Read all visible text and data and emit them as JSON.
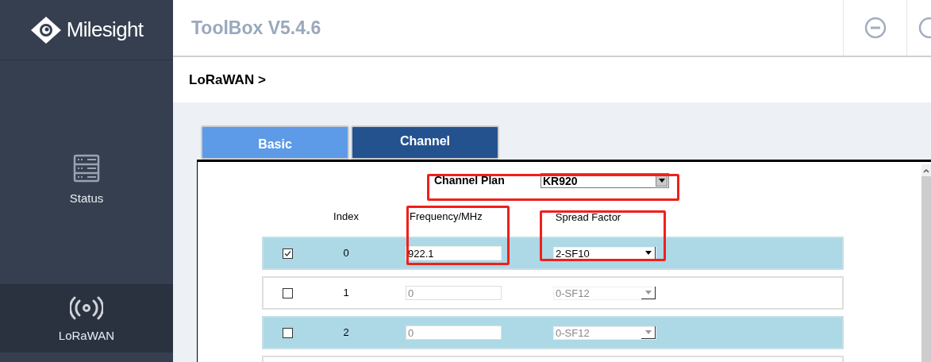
{
  "brand": "Milesight",
  "app_title": "ToolBox V5.4.6",
  "sidebar": {
    "items": [
      {
        "label": "Status",
        "selected": false
      },
      {
        "label": "LoRaWAN",
        "selected": true
      }
    ]
  },
  "breadcrumb": "LoRaWAN >",
  "tabs": [
    {
      "label": "Basic",
      "selected": false
    },
    {
      "label": "Channel",
      "selected": true
    }
  ],
  "channel_plan": {
    "label": "Channel Plan",
    "value": "KR920",
    "highlighted": true
  },
  "table": {
    "columns": [
      {
        "label": "Index",
        "highlighted": false
      },
      {
        "label": "Frequency/MHz",
        "highlighted": true
      },
      {
        "label": "Spread Factor",
        "highlighted": true
      }
    ],
    "rows": [
      {
        "checked": true,
        "index": "0",
        "frequency": "922.1",
        "spread_factor": "2-SF10"
      },
      {
        "checked": false,
        "index": "1",
        "frequency": "0",
        "spread_factor": "0-SF12"
      },
      {
        "checked": false,
        "index": "2",
        "frequency": "0",
        "spread_factor": "0-SF12"
      }
    ]
  }
}
